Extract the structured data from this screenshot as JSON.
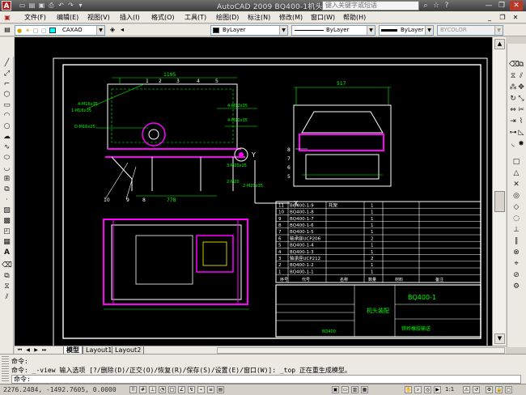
{
  "titlebar": {
    "app_letter": "A",
    "title": "AutoCAD 2009  BQ400-1机头装配",
    "search_placeholder": "键入关键字或短语",
    "icons": [
      "new-icon",
      "open-icon",
      "save-icon",
      "print-icon",
      "undo-icon",
      "redo-icon",
      "dropdown-icon"
    ],
    "right_icons": [
      "binoculars-icon",
      "star-icon",
      "help-icon"
    ],
    "window_buttons": [
      "minimize",
      "restore",
      "close"
    ]
  },
  "menubar": {
    "items": [
      "文件(F)",
      "编辑(E)",
      "视图(V)",
      "插入(I)",
      "格式(O)",
      "工具(T)",
      "绘图(D)",
      "标注(N)",
      "修改(M)",
      "窗口(W)",
      "帮助(H)"
    ]
  },
  "properties_toolbar": {
    "layer_name": "CAXAO",
    "color": "ByLayer",
    "linetype": "ByLayer",
    "lineweight": "ByLayer",
    "plotstyle": "BYCOLOR",
    "layer_color": "#00ffff"
  },
  "drawing": {
    "part_numbers_front": [
      "1",
      "2",
      "3",
      "4",
      "5"
    ],
    "part_numbers_bottom": [
      "10",
      "9",
      "8"
    ],
    "part_numbers_side": [
      "8",
      "7",
      "6",
      "5"
    ],
    "dim_front_top": "1195",
    "dim_front_bottom": "778",
    "dim_side_top": "517",
    "ucs_y": "Y",
    "ucs_x": "X",
    "callouts": [
      "4-M16x35",
      "1-M16x35",
      "D-M16x25",
      "4-M12x35",
      "4-M12x35",
      "3-M20x25",
      "2-M20",
      "2-M20x35"
    ],
    "bom_rows": [
      {
        "no": "11",
        "code": "BQ400-1-9",
        "name": "托架",
        "qty": "1"
      },
      {
        "no": "10",
        "code": "BQ400-1-8",
        "name": "",
        "qty": "1"
      },
      {
        "no": "9",
        "code": "BQ400-1-7",
        "name": "",
        "qty": "1"
      },
      {
        "no": "8",
        "code": "BQ400-1-6",
        "name": "",
        "qty": "1"
      },
      {
        "no": "7",
        "code": "BQ400-1-5",
        "name": "",
        "qty": "1"
      },
      {
        "no": "6",
        "code": "轴承座UCP206",
        "name": "",
        "qty": "2"
      },
      {
        "no": "5",
        "code": "BQ400-1-4",
        "name": "",
        "qty": "1"
      },
      {
        "no": "4",
        "code": "BQ400-1-3",
        "name": "",
        "qty": "1"
      },
      {
        "no": "3",
        "code": "轴承座UCP212",
        "name": "",
        "qty": "2"
      },
      {
        "no": "2",
        "code": "BQ400-1-2",
        "name": "",
        "qty": "1"
      },
      {
        "no": "1",
        "code": "BQ400-1-1",
        "name": "",
        "qty": "1"
      }
    ],
    "bom_header": [
      "序号",
      "代号",
      "名称",
      "数量",
      "材料",
      "备注"
    ],
    "title_block": {
      "drawing_no": "BQ400-1",
      "title": "机头装配",
      "company": "铁岭橡胶输送",
      "company_code": "BQ400"
    }
  },
  "tabs": {
    "items": [
      "模型",
      "Layout1",
      "Layout2"
    ],
    "active": "模型"
  },
  "command": {
    "line1": "命令:",
    "line2": "命令: _-view 输入选项 [?/删除(D)/正交(O)/恢复(R)/保存(S)/设置(E)/窗口(W)]: _top 正在重生成模型。",
    "prompt": "命令:"
  },
  "status": {
    "coords": "2276.2484, -1492.7605, 0.0000",
    "scale": "1:1"
  },
  "colors": {
    "magenta": "#ff00ff",
    "green": "#00ff00",
    "white": "#ffffff",
    "cyan": "#00ffff",
    "yellow": "#ffff00",
    "red": "#ff3030"
  }
}
